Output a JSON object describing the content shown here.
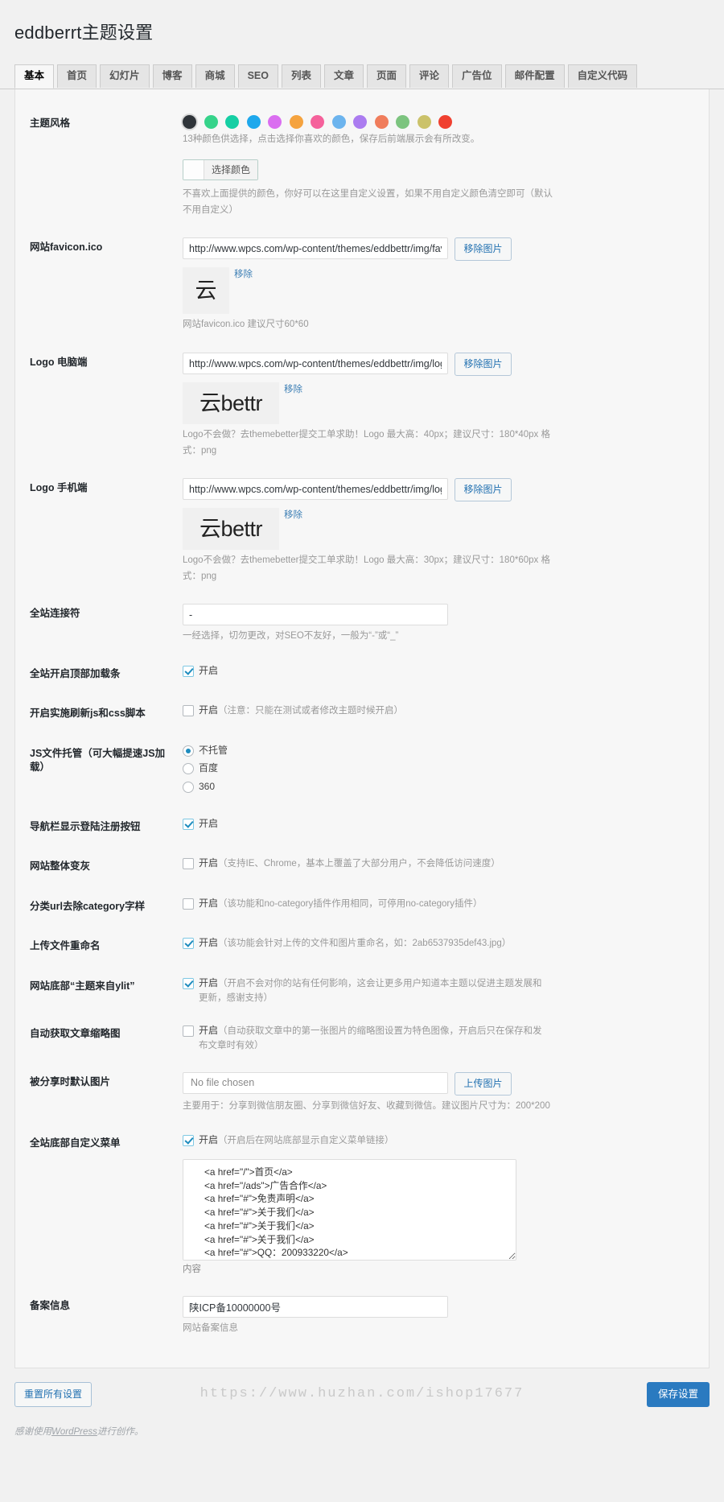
{
  "page_title": "eddberrt主题设置",
  "tabs": [
    {
      "label": "基本",
      "active": true
    },
    {
      "label": "首页",
      "active": false
    },
    {
      "label": "幻灯片",
      "active": false
    },
    {
      "label": "博客",
      "active": false
    },
    {
      "label": "商城",
      "active": false
    },
    {
      "label": "SEO",
      "active": false
    },
    {
      "label": "列表",
      "active": false
    },
    {
      "label": "文章",
      "active": false
    },
    {
      "label": "页面",
      "active": false
    },
    {
      "label": "评论",
      "active": false
    },
    {
      "label": "广告位",
      "active": false
    },
    {
      "label": "邮件配置",
      "active": false
    },
    {
      "label": "自定义代码",
      "active": false
    }
  ],
  "theme_style": {
    "label": "主题风格",
    "swatches": [
      {
        "name": "dark",
        "color": "#2f3439",
        "selected": true
      },
      {
        "name": "green",
        "color": "#36d38a"
      },
      {
        "name": "teal",
        "color": "#16cfa4"
      },
      {
        "name": "blue",
        "color": "#1fa8ec"
      },
      {
        "name": "magenta",
        "color": "#da6ef0"
      },
      {
        "name": "orange",
        "color": "#f5a33f"
      },
      {
        "name": "pink",
        "color": "#f5619b"
      },
      {
        "name": "lightblue",
        "color": "#6cb4ee"
      },
      {
        "name": "purple",
        "color": "#ab7cf0"
      },
      {
        "name": "salmon",
        "color": "#f07d5c"
      },
      {
        "name": "lightgreen",
        "color": "#7cc47f"
      },
      {
        "name": "khaki",
        "color": "#cbc26a"
      },
      {
        "name": "red",
        "color": "#f04030"
      }
    ],
    "desc": "13种颜色供选择，点击选择你喜欢的颜色，保存后前端展示会有所改变。",
    "picker_label": "选择颜色",
    "picker_desc": "不喜欢上面提供的颜色，你好可以在这里自定义设置，如果不用自定义颜色清空即可（默认不用自定义）"
  },
  "favicon": {
    "label": "网站favicon.ico",
    "value": "http://www.wpcs.com/wp-content/themes/eddbettr/img/favico",
    "button": "移除图片",
    "remove_link": "移除",
    "thumb_text": "云",
    "desc": "网站favicon.ico 建议尺寸60*60"
  },
  "logo_pc": {
    "label": "Logo 电脑端",
    "value": "http://www.wpcs.com/wp-content/themes/eddbettr/img/logo.",
    "button": "移除图片",
    "remove_link": "移除",
    "thumb_cn": "云",
    "thumb_en": "bettr",
    "desc": "Logo不会做？去themebetter提交工单求助！Logo 最大高：40px；建议尺寸：180*40px 格式：png"
  },
  "logo_mobile": {
    "label": "Logo 手机端",
    "value": "http://www.wpcs.com/wp-content/themes/eddbettr/img/logo.",
    "button": "移除图片",
    "remove_link": "移除",
    "thumb_cn": "云",
    "thumb_en": "bettr",
    "desc": "Logo不会做？去themebetter提交工单求助！Logo 最大高：30px；建议尺寸：180*60px 格式：png"
  },
  "connector": {
    "label": "全站连接符",
    "value": "-",
    "desc": "一经选择，切勿更改，对SEO不友好，一般为“-”或“_”"
  },
  "topbar": {
    "label": "全站开启顶部加载条",
    "checkbox_label": "开启",
    "checked": true
  },
  "refresh_js": {
    "label": "开启实施刷新js和css脚本",
    "checkbox_label": "开启",
    "note": "（注意：只能在测试或者修改主题时候开启）",
    "checked": false
  },
  "js_host": {
    "label": "JS文件托管（可大幅提速JS加载）",
    "options": [
      {
        "label": "不托管",
        "selected": true
      },
      {
        "label": "百度",
        "selected": false
      },
      {
        "label": "360",
        "selected": false
      }
    ]
  },
  "nav_login": {
    "label": "导航栏显示登陆注册按钮",
    "checkbox_label": "开启",
    "checked": true
  },
  "gray_site": {
    "label": "网站整体变灰",
    "checkbox_label": "开启",
    "note": "（支持IE、Chrome，基本上覆盖了大部分用户，不会降低访问速度）",
    "checked": false
  },
  "category_url": {
    "label": "分类url去除category字样",
    "checkbox_label": "开启",
    "note": "（该功能和no-category插件作用相同，可停用no-category插件）",
    "checked": false
  },
  "upload_rename": {
    "label": "上传文件重命名",
    "checkbox_label": "开启",
    "note": "（该功能会针对上传的文件和图片重命名，如：2ab6537935def43.jpg）",
    "checked": true
  },
  "footer_credit": {
    "label": "网站底部“主题来自ylit”",
    "checkbox_label": "开启",
    "note": "（开启不会对你的站有任何影响，这会让更多用户知道本主题以促进主题发展和更新，感谢支持）",
    "checked": true
  },
  "auto_thumb": {
    "label": "自动获取文章缩略图",
    "checkbox_label": "开启",
    "note": "（自动获取文章中的第一张图片的缩略图设置为特色图像，开启后只在保存和发布文章时有效）",
    "checked": false
  },
  "share_image": {
    "label": "被分享时默认图片",
    "file_placeholder": "No file chosen",
    "button": "上传图片",
    "desc": "主要用于：分享到微信朋友圈、分享到微信好友、收藏到微信。建议图片尺寸为：200*200"
  },
  "footer_menu": {
    "label": "全站底部自定义菜单",
    "checkbox_label": "开启",
    "note": "（开启后在网站底部显示自定义菜单链接）",
    "checked": true,
    "textarea_value": "<a href=\"/\">首页</a>\n<a href=\"/ads\">广告合作</a>\n<a href=\"#\">免责声明</a>\n<a href=\"#\">关于我们</a>\n<a href=\"#\">关于我们</a>\n<a href=\"#\">关于我们</a>\n<a href=\"#\">QQ：200933220</a>\n<a href=\"#\">微信：faecbook</a>",
    "textarea_desc": "内容"
  },
  "beian": {
    "label": "备案信息",
    "value": "陕ICP备10000000号",
    "desc": "网站备案信息"
  },
  "actions": {
    "reset": "重置所有设置",
    "save": "保存设置"
  },
  "watermark": "https://www.huzhan.com/ishop17677",
  "credit": {
    "prefix": "感谢使用",
    "link": "WordPress",
    "suffix": "进行创作。"
  }
}
